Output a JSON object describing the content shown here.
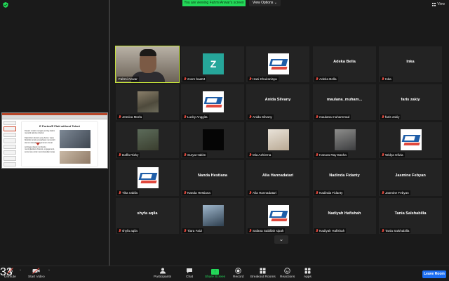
{
  "top": {
    "banner": "You are viewing Fahmi Anwar's screen",
    "view_options": "View Options ⌄",
    "view": "View"
  },
  "share_slide": {
    "title": "E Portes/E Platt without Talent",
    "body": [
      "Desain modern sangat penting dalam menarik talenta milenial",
      "Diperlukan desain yang benar, tepat, fleksibel untuk perusahaan memenuhi elemen desain kenyamanan visual",
      "sehingga dapat membantu meningkatkan efisiensi, engagement, serta rasa untuk memotivasikan kerja"
    ]
  },
  "tiles": [
    {
      "label": "Fahmi Anwar",
      "kind": "camera",
      "muted": false,
      "active": true
    },
    {
      "label": "zoom baa04",
      "kind": "z",
      "muted": true
    },
    {
      "label": "Hani Khairanisya",
      "kind": "logo",
      "muted": true
    },
    {
      "label": "Adeka Bella",
      "kind": "name",
      "big": "Adeka Bella",
      "muted": true
    },
    {
      "label": "Inka",
      "kind": "name",
      "big": "Inka",
      "muted": true
    },
    {
      "label": "Jessica Morla",
      "kind": "photo",
      "photo": "p1",
      "muted": true
    },
    {
      "label": "Lucky Anggita",
      "kind": "logo",
      "muted": true
    },
    {
      "label": "Anida Silvany",
      "kind": "name",
      "big": "Anida Silvany",
      "muted": true
    },
    {
      "label": "maulana muhammad",
      "kind": "name",
      "big": "maulana_muham...",
      "muted": true
    },
    {
      "label": "faris zakiy",
      "kind": "name",
      "big": "faris zakiy",
      "muted": true
    },
    {
      "label": "Daffa Rizky",
      "kind": "photo",
      "photo": "p2",
      "muted": true
    },
    {
      "label": "Surya Hakim",
      "kind": "photo",
      "photo": "p3",
      "muted": true
    },
    {
      "label": "Mia Azhiema",
      "kind": "photo",
      "photo": "p4",
      "muted": true
    },
    {
      "label": "Hanura Ray Basha",
      "kind": "photo",
      "photo": "p5",
      "muted": true
    },
    {
      "label": "Widya Olivia",
      "kind": "logo",
      "muted": true
    },
    {
      "label": "Tika nabila",
      "kind": "logo",
      "muted": true
    },
    {
      "label": "Nanda Hestiana",
      "kind": "name",
      "big": "Nanda Hestiana",
      "muted": true
    },
    {
      "label": "Alia Hannadatari",
      "kind": "name",
      "big": "Alia Hannadatari",
      "muted": true
    },
    {
      "label": "Nadinda Fidanty",
      "kind": "name",
      "big": "Nadinda Fidanty",
      "muted": true
    },
    {
      "label": "Jasmine Febyan",
      "kind": "name",
      "big": "Jasmine Febyan",
      "muted": true
    },
    {
      "label": "shyfa aqila",
      "kind": "name",
      "big": "shyfa aqila",
      "muted": true
    },
    {
      "label": "Tiara Faizi",
      "kind": "photo",
      "photo": "p6",
      "muted": true
    },
    {
      "label": "Safana Sabillah sipah",
      "kind": "logo",
      "muted": true
    },
    {
      "label": "Nadiyah Hafishah",
      "kind": "name",
      "big": "Nadiyah Hafishah",
      "muted": true
    },
    {
      "label": "Tania Salshabilla",
      "kind": "name",
      "big": "Tania Salshabilla",
      "muted": true
    }
  ],
  "toolbar": {
    "unmute": "Unmute",
    "start_video": "Start Video",
    "participants": "Participants",
    "participants_count": "33",
    "chat": "Chat",
    "share_screen": "Share Screen",
    "record": "Record",
    "breakout": "Breakout Rooms",
    "reactions": "Reactions",
    "apps": "Apps",
    "leave": "Leave Room"
  },
  "colors": {
    "active_outline": "#c5e23a",
    "share_green": "#23d959",
    "leave_blue": "#1c6ef2",
    "muted_red": "#e0483d"
  }
}
